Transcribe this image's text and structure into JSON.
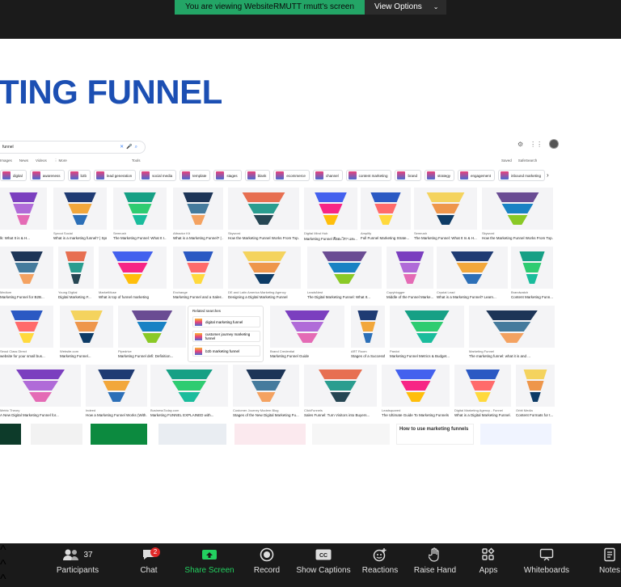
{
  "banner": {
    "message": "You are viewing WebsiteRMUTT rmutt's screen",
    "options_label": "View Options"
  },
  "slide": {
    "title": "TING FUNNEL"
  },
  "google": {
    "query": "funnel",
    "tabs": [
      "Images",
      "News",
      "Videos",
      "⋮ More"
    ],
    "tools": "Tools",
    "saved": "Saved",
    "safesearch": "SafeSearch",
    "chips": [
      "digital",
      "awareness",
      "b2b",
      "lead generation",
      "social media",
      "template",
      "stages",
      "blank",
      "ecommerce",
      "channel",
      "content marketing",
      "brand",
      "strategy",
      "engagement",
      "inbound marketing"
    ]
  },
  "rows": [
    [
      {
        "src": "",
        "cap": "lk: What It is & H..."
      },
      {
        "src": "Sprout Social",
        "cap": "What is a marketing funnel? | Spr..."
      },
      {
        "src": "Semrush",
        "cap": "The Marketing Funnel: What It I..."
      },
      {
        "src": "Attractor Kit",
        "cap": "What is a Marketing Funnel? | ..."
      },
      {
        "src": "Skyword",
        "cap": "How the Marketing Funnel Works From Top..."
      },
      {
        "src": "Digital Mind Hub",
        "cap": "Marketing Funnel คืออะไร? และ..."
      },
      {
        "src": "Amplify",
        "cap": "Full Funnel Marketing Strate..."
      },
      {
        "src": "Semrush",
        "cap": "The Marketing Funnel: What It Is & H..."
      },
      {
        "src": "Skyword",
        "cap": "How the Marketing Funnel Works From Top..."
      }
    ],
    [
      {
        "src": "Medium",
        "cap": "Marketing Funnel for B2B..."
      },
      {
        "src": "Young Digital",
        "cap": "Digital Marketing F..."
      },
      {
        "src": "MarketMuse",
        "cap": "What is top of funnel marketing"
      },
      {
        "src": "Exchange",
        "cap": "Marketing Funnel and a Sales ..."
      },
      {
        "src": "DE and Latin America Marketing Agency",
        "cap": "Designing a Digital Marketing Funnel"
      },
      {
        "src": "LeadsNest",
        "cap": "The Digital Marketing Funnel: What It..."
      },
      {
        "src": "Copyblogger",
        "cap": "Middle of the Funnel Marke..."
      },
      {
        "src": "Crystal Lead",
        "cap": "What is a Marketing Funnel? Learn..."
      },
      {
        "src": "Brandwatch",
        "cap": "Content Marketing Funn..."
      }
    ],
    [
      {
        "src": "Seoul Class Direct",
        "cap": "website for your small bus..."
      },
      {
        "src": "Website.com",
        "cap": "Marketing Funnel..."
      },
      {
        "src": "Pipedrive",
        "cap": "Marketing Funnel defi: Definition..."
      },
      {
        "src": "Brand Credential",
        "cap": "Marketing Funnel Guide"
      },
      {
        "src": "ART Room",
        "cap": "Stages of a Successful..."
      },
      {
        "src": "Pardot",
        "cap": "Marketing Funnel Metrics & Budget..."
      },
      {
        "src": "Marketing Funnel",
        "cap": "The marketing funnel: what it is and ..."
      }
    ],
    [
      {
        "src": "Metric Theory",
        "cap": "A New Digital Marketing Funnel for..."
      },
      {
        "src": "Indeed",
        "cap": "How a Marketing Funnel Works (With..."
      },
      {
        "src": "BusinessToday.com",
        "cap": "Marketing FUNNEL EXPLAINED with..."
      },
      {
        "src": "Customer Journey Modern Blog",
        "cap": "Stages of the New Digital Marketing Fu..."
      },
      {
        "src": "ClickFunnels",
        "cap": "Sales Funnel: Turn Visitors into Buyers..."
      },
      {
        "src": "Leadsquared",
        "cap": "The Ultimate Guide To Marketing Funnels ..."
      },
      {
        "src": "Digital Marketing Agency - Funnel",
        "cap": "What is a Digital Marketing Funnel..."
      },
      {
        "src": "Orbit Media",
        "cap": "Content Formats for t..."
      }
    ]
  ],
  "related": {
    "heading": "Related searches",
    "items": [
      "digital marketing funnel",
      "customer journey marketing funnel",
      "b2b marketing funnel"
    ]
  },
  "bottom_text": "How to use marketing funnels",
  "toolbar": {
    "participants": "Participants",
    "participants_count": "37",
    "chat": "Chat",
    "chat_badge": "2",
    "share": "Share Screen",
    "record": "Record",
    "captions": "Show Captions",
    "reactions": "Reactions",
    "raise": "Raise Hand",
    "apps": "Apps",
    "whiteboards": "Whiteboards",
    "notes": "Notes"
  }
}
